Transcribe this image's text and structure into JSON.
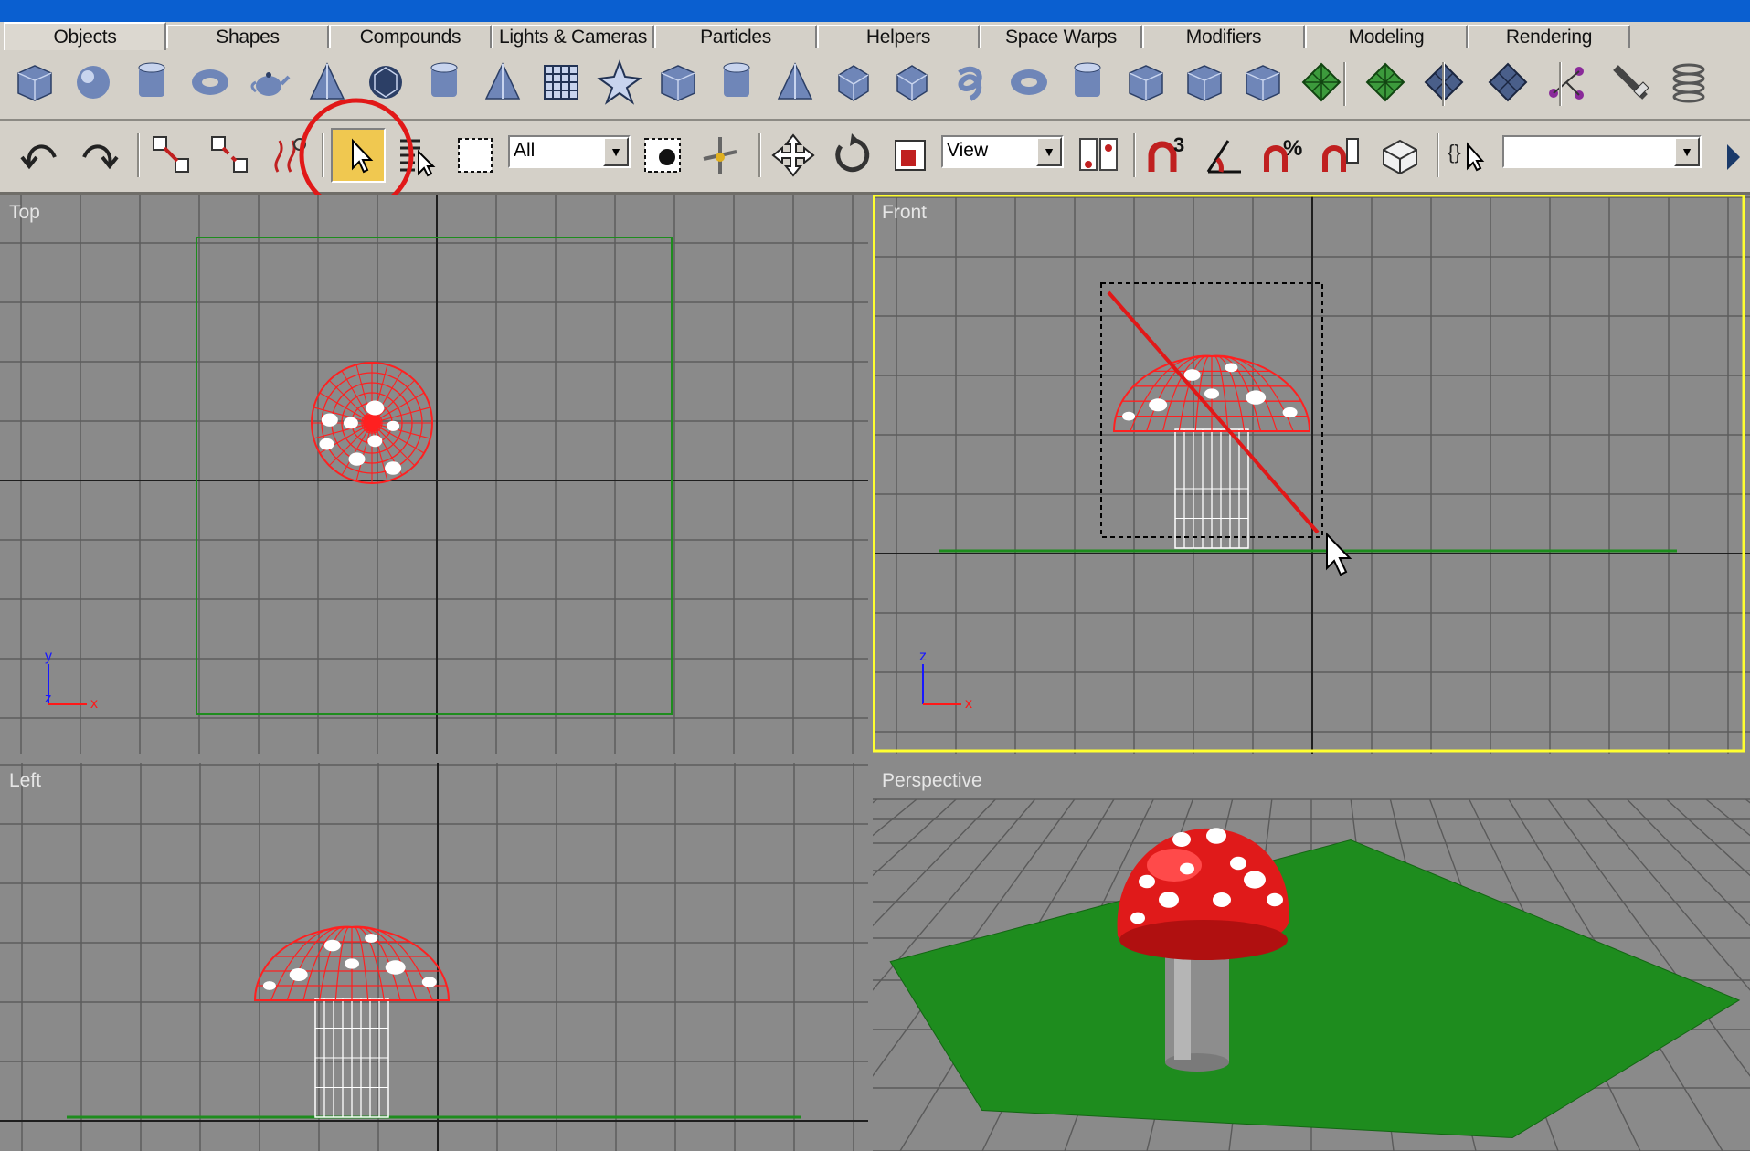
{
  "tabs": [
    {
      "label": "Objects",
      "active": true
    },
    {
      "label": "Shapes"
    },
    {
      "label": "Compounds"
    },
    {
      "label": "Lights & Cameras"
    },
    {
      "label": "Particles"
    },
    {
      "label": "Helpers"
    },
    {
      "label": "Space Warps"
    },
    {
      "label": "Modifiers"
    },
    {
      "label": "Modeling"
    },
    {
      "label": "Rendering"
    }
  ],
  "object_icons": [
    "box-icon",
    "sphere-icon",
    "cylinder-icon",
    "torus-icon",
    "teapot-icon",
    "cone-icon",
    "geosphere-icon",
    "tube-icon",
    "pyramid-icon",
    "plane-icon",
    "hedra-icon",
    "chamfer-box-icon",
    "oil-tank-icon",
    "spindle-icon",
    "gengon-icon",
    "prism-icon",
    "torus-knot-icon",
    "ring-wave-icon",
    "capsule-icon",
    "l-ext-icon",
    "c-ext-icon",
    "hose-icon",
    "grid-green-icon",
    "grid-green2-icon",
    "grid-dark-icon",
    "grid-dark2-icon",
    "bone-icon",
    "gizmo-icon",
    "spring-icon"
  ],
  "main_toolbar": {
    "undo": "undo-icon",
    "redo": "redo-icon",
    "select_and_link": "link-icon",
    "unlink": "unlink-icon",
    "bind_space_warp": "bind-spacewarp-icon",
    "select_object": "select-arrow-icon",
    "select_by_name": "select-by-name-icon",
    "region_select": "rect-region-icon",
    "filter_value": "All",
    "window_crossing": "window-crossing-icon",
    "select_move": "move-icon",
    "select_rotate": "rotate-icon",
    "select_scale": "scale-icon",
    "coord_system_value": "View",
    "pivot": "pivot-icon",
    "snap_3": "3",
    "snap_percent": "%",
    "named_selection_value": ""
  },
  "viewports": {
    "top": {
      "label": "Top",
      "axis_x": "x",
      "axis_y": "y",
      "axis_z": "z"
    },
    "front": {
      "label": "Front",
      "active": true,
      "axis_x": "x",
      "axis_z": "z"
    },
    "left": {
      "label": "Left"
    },
    "perspective": {
      "label": "Perspective"
    }
  },
  "colors": {
    "viewport_bg": "#8a8a8a",
    "grid": "#5c5c5c",
    "axis": "#1e1e1e",
    "selected_wire": "#ff2020",
    "ground": "#1e8c1e",
    "active_border": "#ffff30",
    "annotation": "#e11818"
  }
}
